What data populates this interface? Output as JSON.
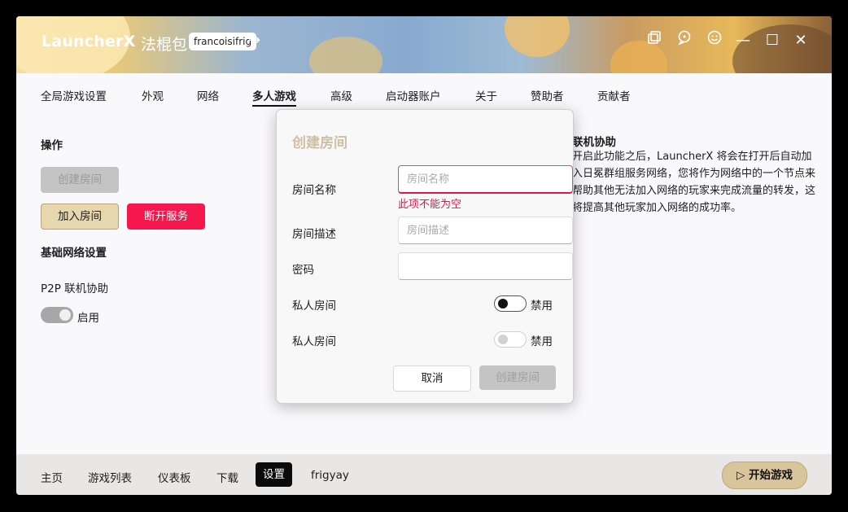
{
  "window": {
    "app_title": "LauncherX",
    "modpack_name": "法棍包",
    "username": "francoisifrig",
    "controls": {
      "restore_icon": "copy-window-icon",
      "feedback_icon": "chat-help-icon",
      "emoji_icon": "smile-icon",
      "minimize_glyph": "—",
      "maximize_glyph": "☐",
      "close_glyph": "✕"
    }
  },
  "tabs": [
    "全局游戏设置",
    "外观",
    "网络",
    "多人游戏",
    "高级",
    "启动器账户",
    "关于",
    "赞助者",
    "贡献者"
  ],
  "active_tab": "多人游戏",
  "operations": {
    "title": "操作",
    "create_room": "创建房间",
    "join_room": "加入房间",
    "disconnect": "断开服务"
  },
  "network": {
    "title": "基础网络设置",
    "p2p_label": "P2P 联机协助",
    "p2p_state": "启用"
  },
  "assist": {
    "title": "联机协助",
    "description": "开启此功能之后，LauncherX 将会在打开后自动加入日冕群组服务网络，您将作为网络中的一个节点来帮助其他无法加入网络的玩家来完成流量的转发，这将提高其他玩家加入网络的成功率。"
  },
  "modal": {
    "title": "创建房间",
    "room_name_label": "房间名称",
    "room_name_placeholder": "房间名称",
    "room_name_error": "此项不能为空",
    "room_desc_label": "房间描述",
    "room_desc_placeholder": "房间描述",
    "password_label": "密码",
    "private_label_1": "私人房间",
    "private_state_1": "禁用",
    "private_label_2": "私人房间",
    "private_state_2": "禁用",
    "cancel": "取消",
    "create": "创建房间"
  },
  "bottom_nav": [
    "主页",
    "游戏列表",
    "仪表板",
    "下载",
    "设置",
    "frigyay"
  ],
  "active_bottom": "设置",
  "play_button": "开始游戏",
  "colors": {
    "accent_red": "#f5174d",
    "error_red": "#e0164a",
    "join_beige": "#e7d7af",
    "modal_title": "#cdbfa2"
  }
}
